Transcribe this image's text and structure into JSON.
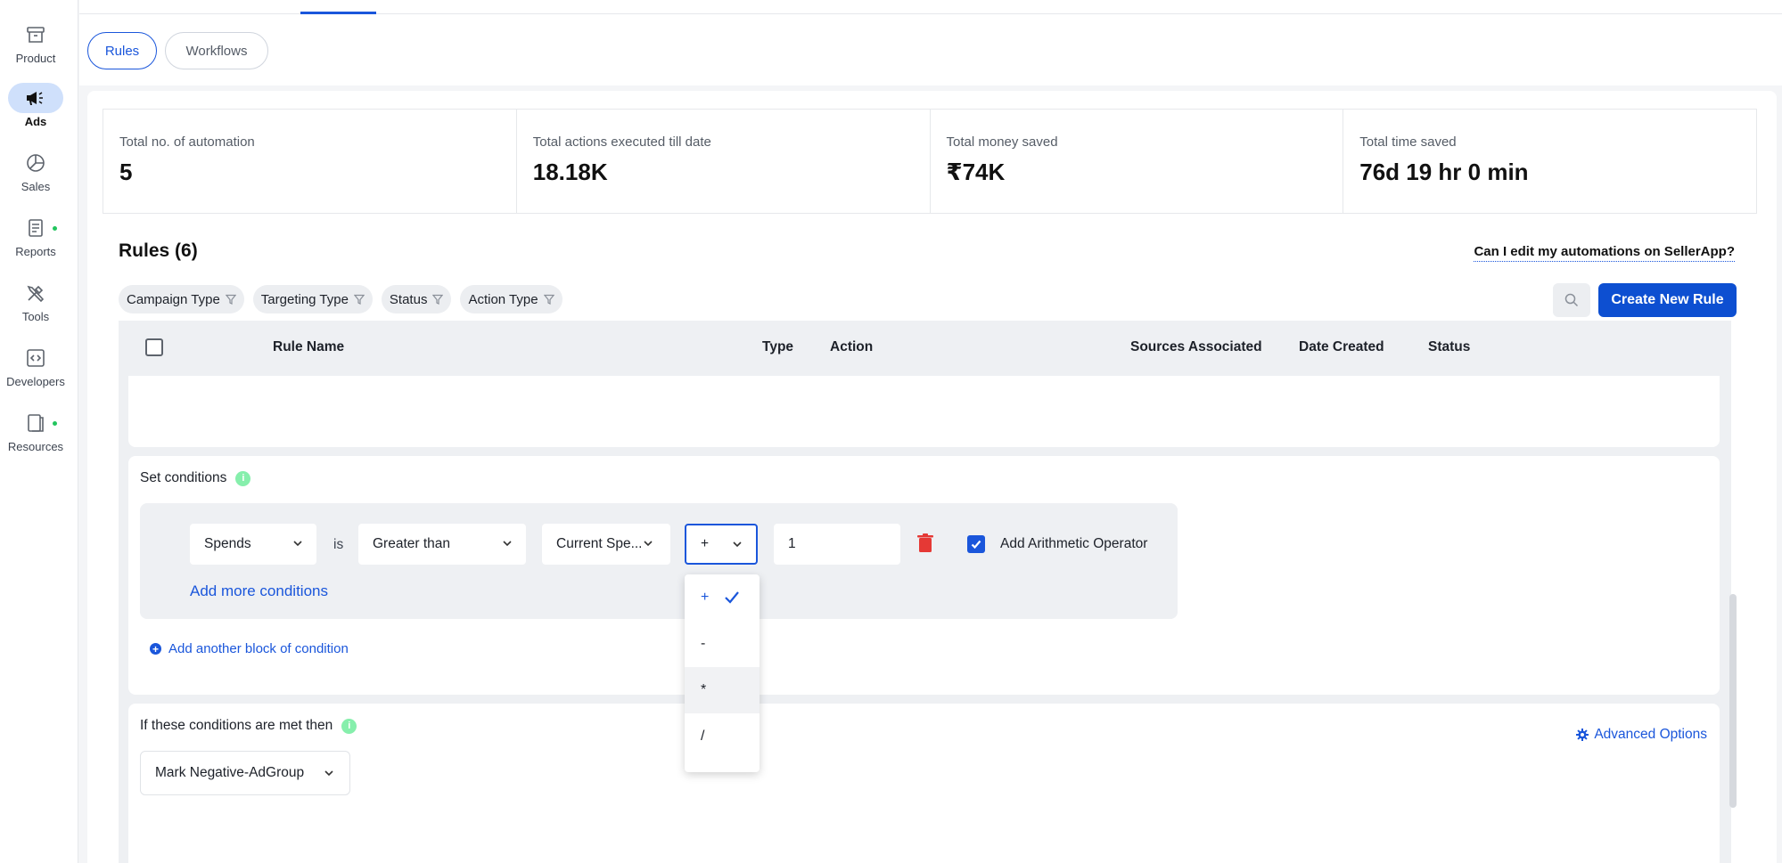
{
  "sidebar": {
    "items": [
      {
        "label": "Product",
        "icon": "archive-box-icon",
        "active": false
      },
      {
        "label": "Ads",
        "icon": "megaphone-icon",
        "active": true
      },
      {
        "label": "Sales",
        "icon": "pie-chart-icon",
        "active": false
      },
      {
        "label": "Reports",
        "icon": "document-icon",
        "active": false,
        "dot": true
      },
      {
        "label": "Tools",
        "icon": "tools-icon",
        "active": false
      },
      {
        "label": "Developers",
        "icon": "code-icon",
        "active": false
      },
      {
        "label": "Resources",
        "icon": "book-icon",
        "active": false,
        "dot": true
      }
    ]
  },
  "tabs": {
    "rules": "Rules",
    "workflows": "Workflows"
  },
  "stats": [
    {
      "label": "Total no. of automation",
      "value": "5"
    },
    {
      "label": "Total actions executed till date",
      "value": "18.18K"
    },
    {
      "label": "Total money saved",
      "value": "₹74K"
    },
    {
      "label": "Total time saved",
      "value": "76d 19 hr 0 min"
    }
  ],
  "rules": {
    "title": "Rules (6)",
    "help_link": "Can I edit my automations on SellerApp?",
    "filters": [
      "Campaign Type",
      "Targeting Type",
      "Status",
      "Action Type"
    ],
    "create_button": "Create New Rule",
    "columns": {
      "rule_name": "Rule Name",
      "type": "Type",
      "action": "Action",
      "sources": "Sources Associated",
      "date_created": "Date Created",
      "status": "Status"
    }
  },
  "conditions": {
    "title": "Set conditions",
    "metric": "Spends",
    "is_label": "is",
    "comparator": "Greater than",
    "reference": "Current Spe...",
    "operator": "+",
    "operand": "1",
    "arith_label": "Add Arithmetic Operator",
    "add_more": "Add more conditions",
    "add_block": "Add another block of condition",
    "operator_options": [
      "+",
      "-",
      "*",
      "/"
    ]
  },
  "then": {
    "title": "If these conditions are met then",
    "advanced": "Advanced Options",
    "action": "Mark Negative-AdGroup"
  },
  "colors": {
    "accent": "#1a56db",
    "primary_button": "#0d4fd1",
    "danger": "#e53935",
    "success": "#22c55e"
  }
}
